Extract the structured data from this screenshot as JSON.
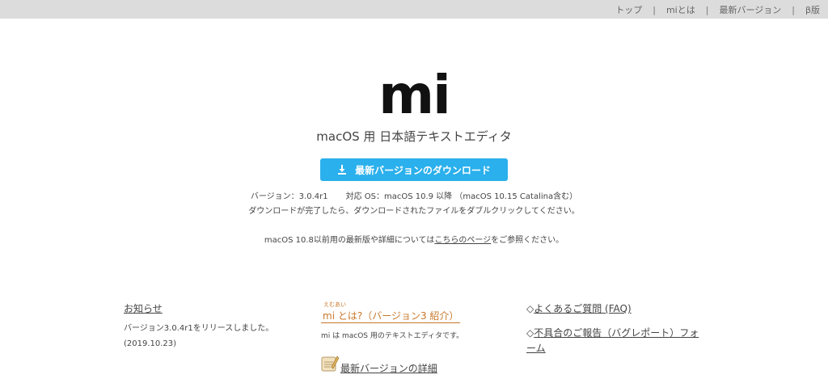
{
  "topnav": {
    "items": [
      "トップ",
      "miとは",
      "最新バージョン",
      "β版"
    ]
  },
  "hero": {
    "logo": "mi",
    "tagline": "macOS 用 日本語テキストエディタ",
    "download_label": "最新バージョンのダウンロード",
    "version_text": "バージョン：3.0.4r1",
    "os_text": "対応 OS：macOS 10.9 以降 （macOS 10.15 Catalina含む）",
    "instructions": "ダウンロードが完了したら、ダウンロードされたファイルをダブルクリックしてください。",
    "legacy_prefix": "macOS 10.8以前用の最新版や詳細については",
    "legacy_link": "こちらのページ",
    "legacy_suffix": "をご参照ください。"
  },
  "news": {
    "heading": "お知らせ",
    "body": "バージョン3.0.4r1をリリースしました。",
    "date": "(2019.10.23)"
  },
  "about": {
    "ruby": "えむあい",
    "link": "mi とは?（バージョン3 紹介）",
    "desc": "mi は macOS 用のテキストエディタです。",
    "latest_link": "最新バージョンの詳細"
  },
  "faq": {
    "item1": "よくあるご質問 (FAQ)",
    "item2": "不具合のご報告（バグレポート）フォーム",
    "marker": "◇"
  },
  "colors": {
    "topbar": "#dcdcdc",
    "button": "#2ab0ec",
    "accent_link": "#c8782a"
  }
}
